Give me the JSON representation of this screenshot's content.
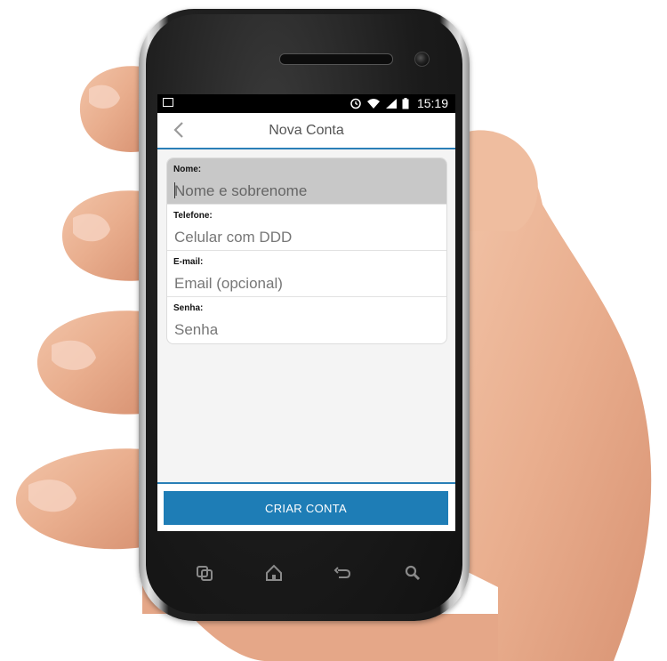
{
  "statusbar": {
    "time": "15:19"
  },
  "topbar": {
    "title": "Nova Conta"
  },
  "form": {
    "fields": [
      {
        "label": "Nome:",
        "placeholder": "Nome e sobrenome"
      },
      {
        "label": "Telefone:",
        "placeholder": "Celular com DDD"
      },
      {
        "label": "E-mail:",
        "placeholder": "Email (opcional)"
      },
      {
        "label": "Senha:",
        "placeholder": "Senha"
      }
    ]
  },
  "actions": {
    "create_label": "CRIAR CONTA"
  },
  "colors": {
    "accent": "#1e7db6",
    "divider": "#2a7fb7",
    "screen_bg": "#f4f4f4"
  }
}
